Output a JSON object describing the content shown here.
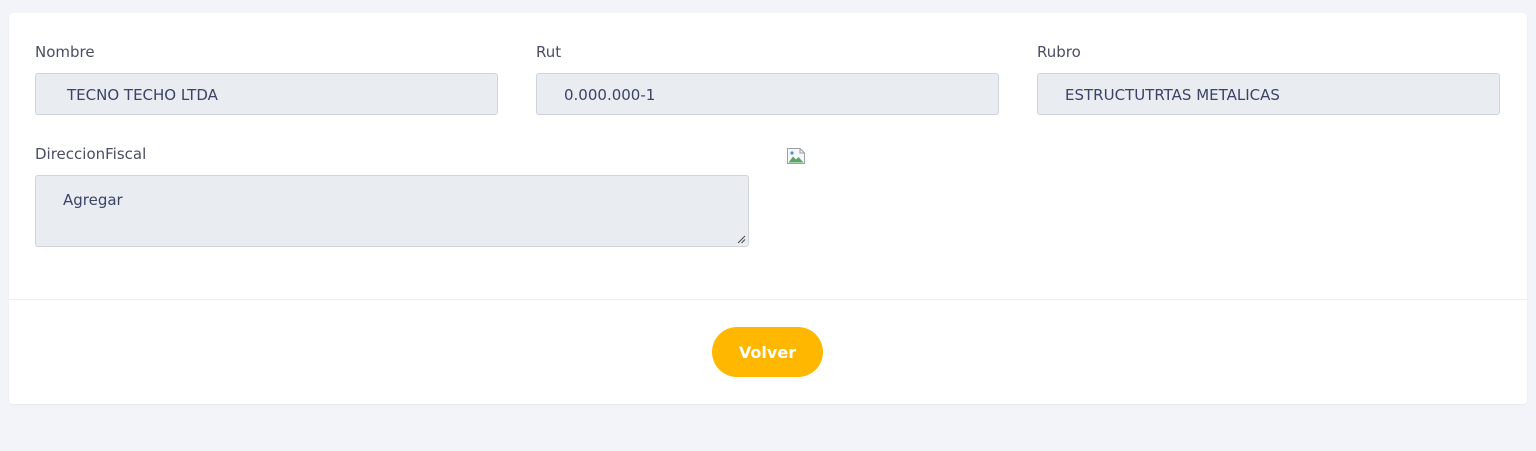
{
  "form": {
    "nombre": {
      "label": "Nombre",
      "value": "TECNO TECHO LTDA"
    },
    "rut": {
      "label": "Rut",
      "value": "0.000.000-1"
    },
    "rubro": {
      "label": "Rubro",
      "value": "ESTRUCTUTRTAS METALICAS"
    },
    "direccion_fiscal": {
      "label": "DireccionFiscal",
      "value": "Agregar"
    }
  },
  "footer": {
    "volver_label": "Volver"
  },
  "colors": {
    "page_background": "#f3f4f9",
    "card_background": "#ffffff",
    "input_background": "#e9ecf0",
    "input_text": "#3b4366",
    "button_background": "#ffb700",
    "button_text": "#ffffff"
  },
  "icons": {
    "image_placeholder": "broken-image-icon",
    "resize": "resize-handle-icon"
  }
}
